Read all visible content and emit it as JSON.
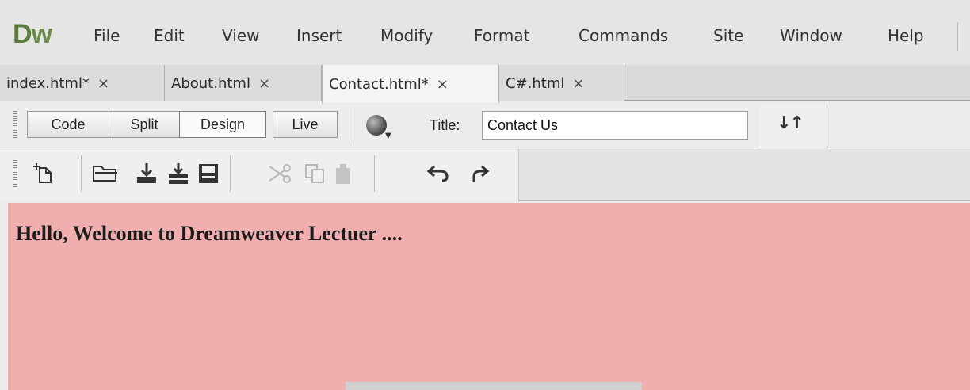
{
  "app": {
    "logo_d": "D",
    "logo_w": "w",
    "logo_color": "#5c7c3e"
  },
  "menu": [
    "File",
    "Edit",
    "View",
    "Insert",
    "Modify",
    "Format",
    "Commands",
    "Site",
    "Window",
    "Help"
  ],
  "tabs": [
    {
      "label": "index.html*",
      "close": "×",
      "active": false
    },
    {
      "label": "About.html",
      "close": "×",
      "active": false
    },
    {
      "label": "Contact.html*",
      "close": "×",
      "active": true
    },
    {
      "label": "C#.html",
      "close": "×",
      "active": false
    }
  ],
  "document_toolbar": {
    "views": [
      "Code",
      "Split",
      "Design",
      "Live"
    ],
    "selected_view": "Design",
    "title_label": "Title:",
    "title_value": "Contact Us",
    "globe_icon": "browser-preview-icon",
    "sort_icon": "file-management-icon"
  },
  "standard_toolbar": {
    "icons": [
      "new-document-icon",
      "open-icon",
      "save-icon",
      "save-all-icon",
      "print-icon",
      "cut-icon",
      "copy-icon",
      "paste-icon",
      "undo-icon",
      "redo-icon"
    ],
    "disabled": [
      "cut-icon",
      "copy-icon",
      "paste-icon"
    ]
  },
  "canvas": {
    "heading": "Hello, Welcome to Dreamweaver Lectuer ....",
    "background": "#f0aeae"
  }
}
